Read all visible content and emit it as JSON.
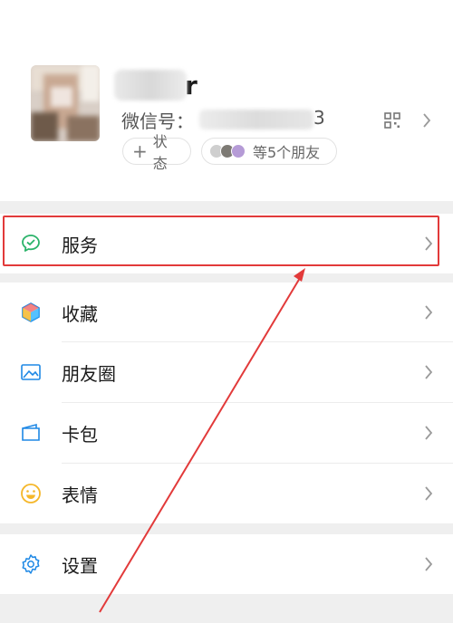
{
  "profile": {
    "name_visible": "r",
    "wechat_id_label": "微信号：",
    "wechat_id_tail": "3",
    "status_chip": "状态",
    "status_plus": "+",
    "friends_chip": "等5个朋友"
  },
  "menu": [
    {
      "label": "服务",
      "icon": "services-icon"
    },
    {
      "label": "收藏",
      "icon": "favorites-icon"
    },
    {
      "label": "朋友圈",
      "icon": "moments-icon"
    },
    {
      "label": "卡包",
      "icon": "cards-icon"
    },
    {
      "label": "表情",
      "icon": "stickers-icon"
    },
    {
      "label": "设置",
      "icon": "settings-icon"
    }
  ],
  "colors": {
    "highlight": "#e23a3a",
    "green": "#2bb36a",
    "blue": "#1e88e5",
    "yellow": "#f5b72a"
  }
}
